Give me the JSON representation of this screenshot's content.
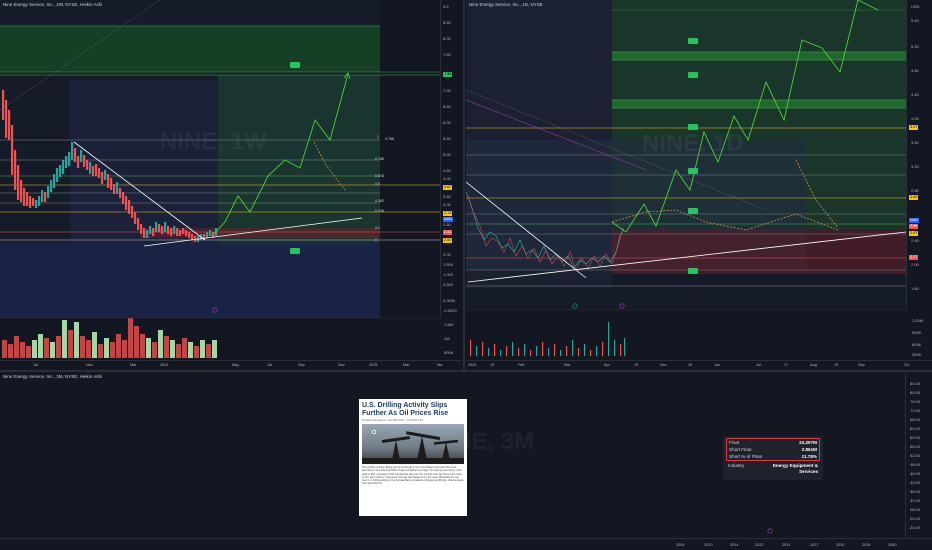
{
  "left_chart": {
    "title": "Nine Energy Service, Inc., 1W, NYSE, Heikin Ashi",
    "price_axis": [
      "0.5",
      "8.50",
      "8.00",
      "7.50",
      "7.00",
      "6.50",
      "6.00",
      "5.50",
      "5.00",
      "4.50",
      "4.00",
      "3.50",
      "3.00",
      "2.50",
      "2.00",
      "1.500",
      "1.000",
      "0.500",
      "0.0000",
      "-0.5000"
    ],
    "price_tags": [
      {
        "text": "7.96",
        "color": "#22c55e"
      },
      {
        "text": "3.67",
        "color": "#f5c518"
      },
      {
        "text": "2.73",
        "color": "#f5c518"
      },
      {
        "text": "NaN",
        "color": "#2962ff"
      },
      {
        "text": "2.41",
        "color": "#ef5350"
      },
      {
        "text": "2.00",
        "color": "#f5c518"
      }
    ],
    "fib_labels": [
      "0.786",
      "0.786",
      "0.618",
      "0.5",
      "0.382",
      "0.236",
      "0.1",
      "0",
      "1"
    ],
    "time_axis": [
      "Jul",
      "Nov",
      "Mar",
      "2024",
      "May",
      "Jul",
      "Sep",
      "Nov",
      "2025",
      "Mar",
      "Ma"
    ],
    "volume_axis": [
      "1.5M",
      "1M",
      "500K"
    ],
    "watermark": "NINE, 1W"
  },
  "right_chart": {
    "title": "Nine Energy Service, Inc., 1D, NYSE",
    "price_axis": [
      "USD",
      "5.60",
      "5.20",
      "4.80",
      "4.40",
      "4.00",
      "3.60",
      "3.20",
      "2.80",
      "2.40",
      "2.00",
      "1.60"
    ],
    "price_tags": [
      {
        "text": "3.47",
        "color": "#f5c518"
      },
      {
        "text": "3.00",
        "color": "#f5c518"
      },
      {
        "text": "NaN",
        "color": "#2962ff"
      },
      {
        "text": "2.59",
        "color": "#ef5350"
      },
      {
        "text": "2.47",
        "color": "#f5c518"
      },
      {
        "text": "2.17",
        "color": "#ef5350"
      }
    ],
    "time_axis": [
      "2024",
      "15",
      "Feb",
      "Mar",
      "Apr",
      "15",
      "Dec",
      "15",
      "Jun",
      "Jul",
      "17",
      "Aug",
      "15",
      "Sep",
      "Oc"
    ],
    "volume_axis": [
      "1.25M",
      "900K",
      "600K",
      "300K"
    ],
    "watermark": "NINE, 1D"
  },
  "bottom_chart": {
    "title": "Nine Energy Service, Inc., 3M, NYSE, Heikin Ashi",
    "price_axis": [
      "84.00",
      "80.00",
      "76.00",
      "72.00",
      "68.00",
      "64.00",
      "60.00",
      "56.00",
      "52.00",
      "48.00",
      "44.00",
      "40.00",
      "36.00",
      "32.00",
      "28.00",
      "24.00",
      "20.00"
    ],
    "time_axis": [
      "2005",
      "2010",
      "2014",
      "2022",
      "2024",
      "2027",
      "2030",
      "2038",
      "2040"
    ],
    "watermark": "NINE, 3M"
  },
  "news": {
    "headline": "U.S. Drilling Activity Slips Further As Oil Prices Rise",
    "byline": "Tsvetana Paraskova · Jan 26th 2024 · 11:15 AM CST",
    "body": "The number of active drilling rigs for oil and gas in the United States decreased this week, according to new data from Baker Hughes published on Friday. The total rig count fell by 1 this week to 619, compared to 663 rigs this time last year. The number of oil rigs fell by 2 this week to 497, after rising by 2 last week. Gas rigs held steady at 117 this week. Miscellaneous rigs rose by 1. Drilling activity in the Permian Basin remained unchanged at 309 rigs, while the Eagle Ford was flat at 53."
  },
  "float_box": {
    "rows": [
      {
        "label": "Float",
        "value": "24.297M"
      },
      {
        "label": "Short Float",
        "value": "2.861M"
      },
      {
        "label": "Short % of Float",
        "value": "11.78%"
      }
    ],
    "industry_label": "Industry",
    "industry_value": "Energy Equipment & Services"
  }
}
